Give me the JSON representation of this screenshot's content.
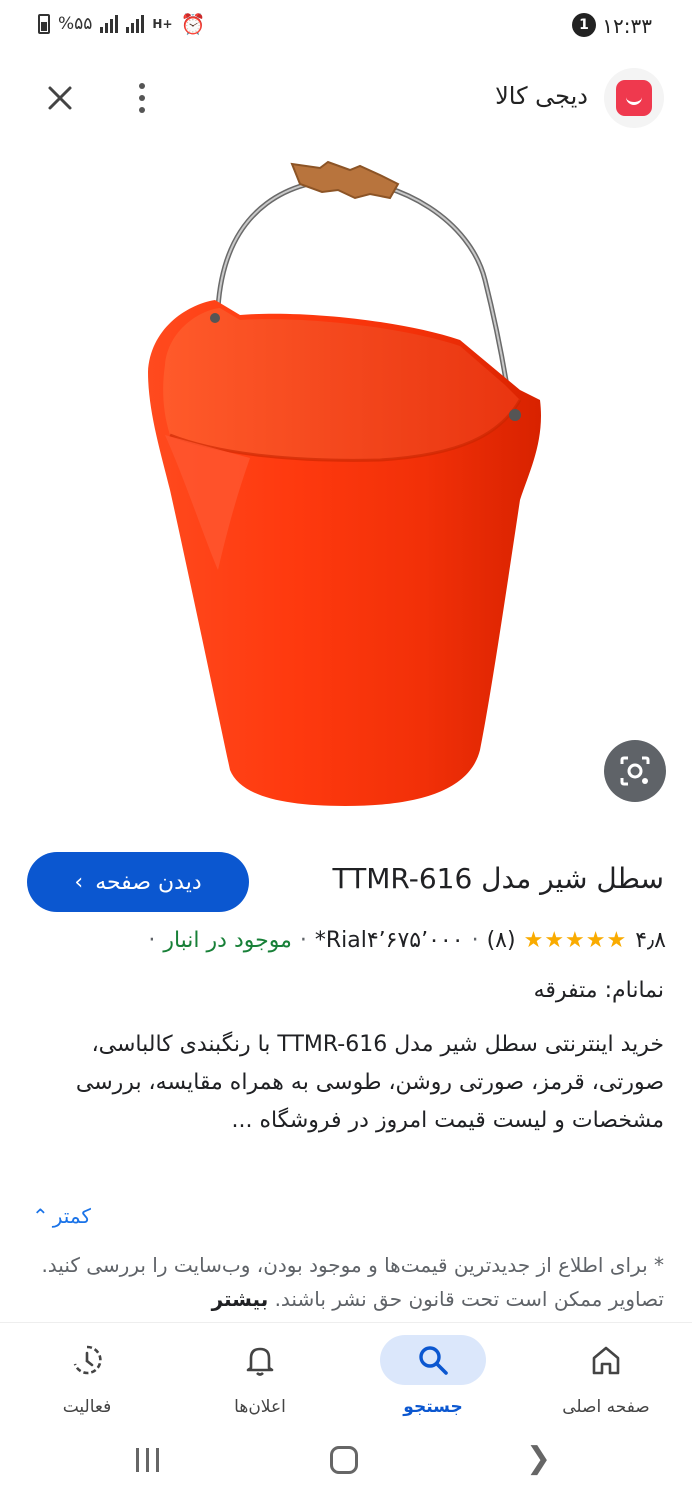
{
  "status_bar": {
    "time": "۱۲:۳۳",
    "notification_count": "1",
    "battery_percent": "%۵۵",
    "network": "H+"
  },
  "top_bar": {
    "site_name": "دیجی کالا",
    "logo_color": "#ef394e"
  },
  "product": {
    "image_desc_icon": "red-bucket-with-metal-handle",
    "title": "سطل شیر مدل TTMR-616",
    "visit_label": "دیدن صفحه",
    "rating": "۴٫۸",
    "stars": "★★★★★",
    "review_count": "(۸)",
    "price": "Rial۴٬۶۷۵٬۰۰۰*",
    "stock": "موجود در انبار",
    "separator": "·",
    "brand_line": "نمانام: متفرقه",
    "description": "خرید اینترنتی سطل شیر مدل TTMR-616 با رنگبندی کالباسی، صورتی، قرمز، صورتی روشن، طوسی به همراه مقایسه، بررسی مشخصات و لیست قیمت امروز در فروشگاه ...",
    "less_label": "کمتر",
    "disclaimer_text": "* برای اطلاع از جدیدترین قیمت‌ها و موجود بودن، وب‌سایت را بررسی کنید. تصاویر ممکن است تحت قانون حق نشر باشند. ",
    "disclaimer_more": "بیشتر"
  },
  "bottom_nav": {
    "items": [
      {
        "label": "صفحه اصلی",
        "icon": "home-icon"
      },
      {
        "label": "جستجو",
        "icon": "search-icon"
      },
      {
        "label": "اعلان‌ها",
        "icon": "bell-icon"
      },
      {
        "label": "فعالیت",
        "icon": "activity-icon"
      }
    ],
    "active_color": "#0b57d0"
  },
  "colors": {
    "accent": "#0b57d0",
    "stars": "#f9ab00",
    "stock": "#188038",
    "bucket": "#f52a10"
  }
}
